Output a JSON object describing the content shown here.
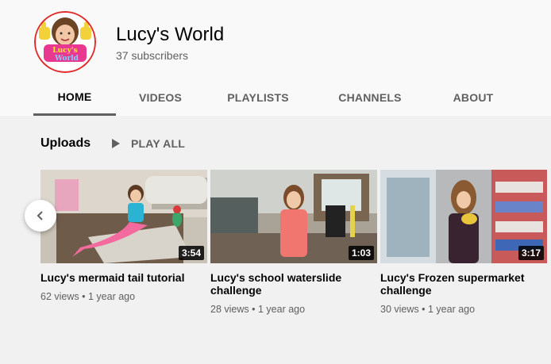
{
  "channel": {
    "name": "Lucy's World",
    "subscribers": "37 subscribers",
    "avatar_logo_text": "Lucy's World"
  },
  "tabs": [
    {
      "label": "HOME",
      "active": true
    },
    {
      "label": "VIDEOS",
      "active": false
    },
    {
      "label": "PLAYLISTS",
      "active": false
    },
    {
      "label": "CHANNELS",
      "active": false
    },
    {
      "label": "ABOUT",
      "active": false
    }
  ],
  "uploads": {
    "title": "Uploads",
    "play_all": "PLAY ALL",
    "prev_icon": "chevron-left-icon"
  },
  "videos": [
    {
      "title": "Lucy's mermaid tail tutorial",
      "views": "62 views",
      "age": "1 year ago",
      "duration": "3:54"
    },
    {
      "title": "Lucy's school waterslide challenge",
      "views": "28 views",
      "age": "1 year ago",
      "duration": "1:03"
    },
    {
      "title": "Lucy's Frozen supermarket challenge",
      "views": "30 views",
      "age": "1 year ago",
      "duration": "3:17"
    }
  ],
  "colors": {
    "header_bg": "#f9f9f9",
    "page_bg": "#f1f1f1",
    "text_primary": "#030303",
    "text_secondary": "#606060"
  }
}
